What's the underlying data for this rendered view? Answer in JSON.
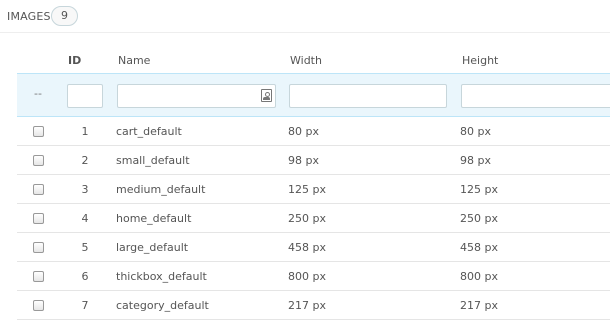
{
  "panel": {
    "title": "IMAGES",
    "count": "9"
  },
  "columns": {
    "id": "ID",
    "name": "Name",
    "width": "Width",
    "height": "Height"
  },
  "filters": {
    "dash": "--",
    "id": "",
    "name": "",
    "width": "",
    "height": ""
  },
  "rows": [
    {
      "id": "1",
      "name": "cart_default",
      "width": "80 px",
      "height": "80 px"
    },
    {
      "id": "2",
      "name": "small_default",
      "width": "98 px",
      "height": "98 px"
    },
    {
      "id": "3",
      "name": "medium_default",
      "width": "125 px",
      "height": "125 px"
    },
    {
      "id": "4",
      "name": "home_default",
      "width": "250 px",
      "height": "250 px"
    },
    {
      "id": "5",
      "name": "large_default",
      "width": "458 px",
      "height": "458 px"
    },
    {
      "id": "6",
      "name": "thickbox_default",
      "width": "800 px",
      "height": "800 px"
    },
    {
      "id": "7",
      "name": "category_default",
      "width": "217 px",
      "height": "217 px"
    }
  ]
}
